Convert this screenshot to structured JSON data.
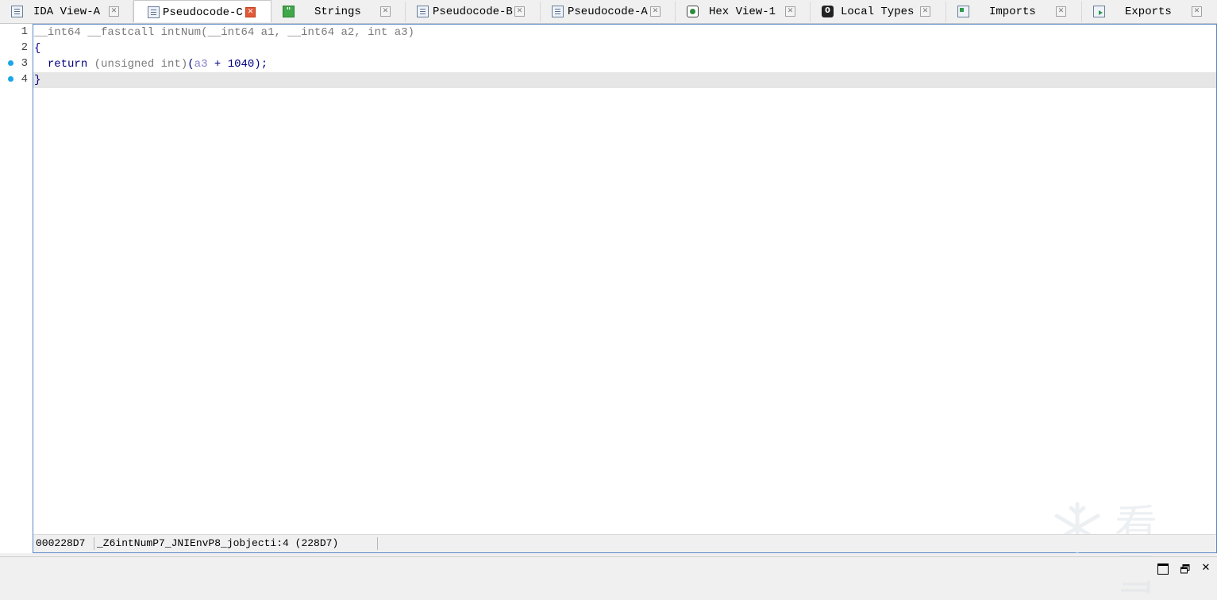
{
  "tabs": [
    {
      "label": "IDA View-A",
      "icon": "list-icon",
      "active": false
    },
    {
      "label": "Pseudocode-C",
      "icon": "list-icon",
      "active": true
    },
    {
      "label": "Strings",
      "icon": "strings-icon",
      "active": false
    },
    {
      "label": "Pseudocode-B",
      "icon": "list-icon",
      "active": false
    },
    {
      "label": "Pseudocode-A",
      "icon": "list-icon",
      "active": false
    },
    {
      "label": "Hex View-1",
      "icon": "hex-icon",
      "active": false
    },
    {
      "label": "Local Types",
      "icon": "local-types-icon",
      "active": false
    },
    {
      "label": "Imports",
      "icon": "imports-icon",
      "active": false
    },
    {
      "label": "Exports",
      "icon": "exports-icon",
      "active": false
    }
  ],
  "editor": {
    "line_numbers": [
      "1",
      "2",
      "3",
      "4"
    ],
    "breakpoint_lines": [
      "3",
      "4"
    ],
    "lines": {
      "l1": {
        "ret_type": "__int64 __fastcall ",
        "func_name": "intNum",
        "open_paren": "(",
        "params": "__int64 a1, __int64 a2, int a3",
        "close_paren": ")"
      },
      "l2": {
        "text": "{"
      },
      "l3": {
        "indent": "  ",
        "kw": "return",
        "space": " ",
        "cast": "(unsigned int)",
        "open": "(",
        "var": "a3",
        "rest": " + 1040);"
      },
      "l4": {
        "text": "}"
      }
    }
  },
  "status": {
    "address": "000228D7",
    "location": "_Z6intNumP7_JNIEnvP8_jobjecti:4 (228D7)"
  },
  "watermark": {
    "text": "看雪"
  },
  "colors": {
    "accent_border": "#5b87c7",
    "breakpoint": "#1aa7e8",
    "active_close": "#e05a3a",
    "highlight_line": "#e6e6e6"
  }
}
